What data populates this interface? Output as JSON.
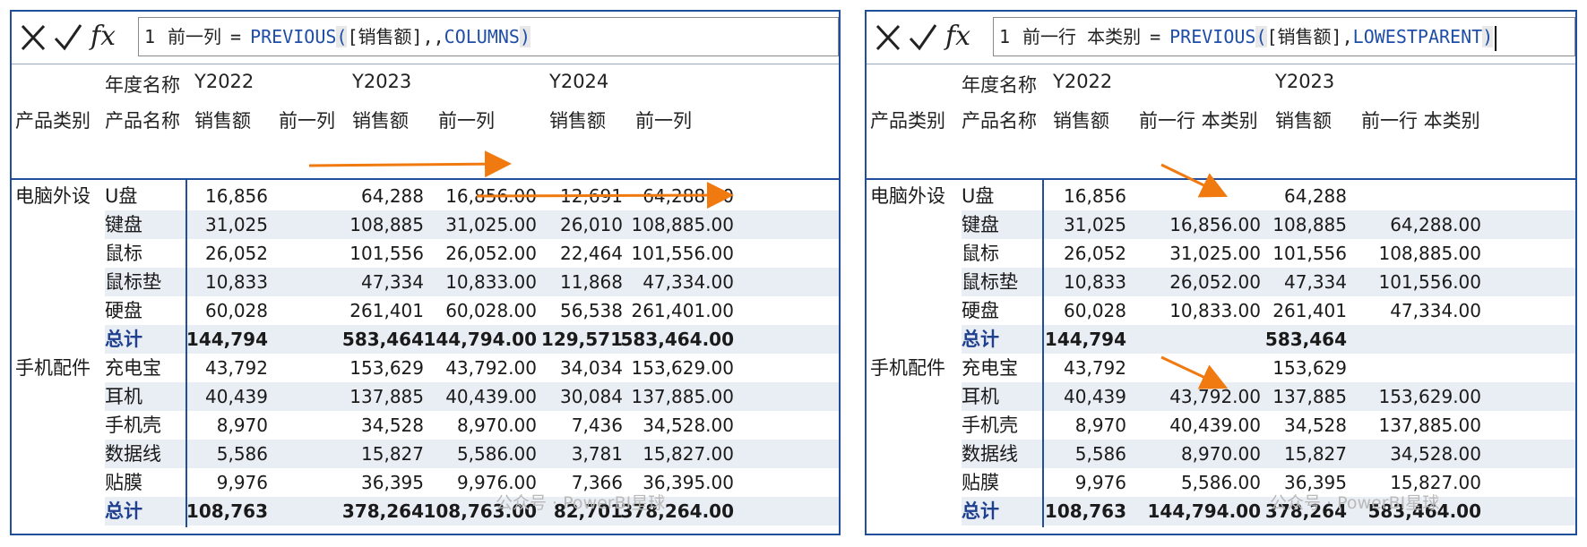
{
  "colors": {
    "border": "#1f4e9b",
    "arrow": "#f07a10",
    "band": "#e9edf4",
    "func": "#1f4ea8"
  },
  "left": {
    "toolbar": {
      "cancel_icon": "close-icon",
      "commit_icon": "check-icon",
      "fx_label": "fx"
    },
    "formula": {
      "line": "1",
      "name": "前一列",
      "eq": "=",
      "func": "PREVIOUS",
      "open": "(",
      "ref": "[销售额]",
      "sep": ",,",
      "kw": "COLUMNS",
      "close": ")"
    },
    "headers": {
      "year_name": "年度名称",
      "product_category": "产品类别",
      "product_name": "产品名称",
      "years": [
        "Y2022",
        "Y2023",
        "Y2024"
      ],
      "measures": [
        "销售额",
        "前一列",
        "销售额",
        "前一列",
        "销售额",
        "前一列"
      ]
    },
    "groups": [
      {
        "category": "电脑外设",
        "rows": [
          {
            "name": "U盘",
            "v": [
              "16,856",
              "",
              "64,288",
              "16,856.00",
              "12,691",
              "64,288.00"
            ]
          },
          {
            "name": "键盘",
            "v": [
              "31,025",
              "",
              "108,885",
              "31,025.00",
              "26,010",
              "108,885.00"
            ]
          },
          {
            "name": "鼠标",
            "v": [
              "26,052",
              "",
              "101,556",
              "26,052.00",
              "22,464",
              "101,556.00"
            ]
          },
          {
            "name": "鼠标垫",
            "v": [
              "10,833",
              "",
              "47,334",
              "10,833.00",
              "11,868",
              "47,334.00"
            ]
          },
          {
            "name": "硬盘",
            "v": [
              "60,028",
              "",
              "261,401",
              "60,028.00",
              "56,538",
              "261,401.00"
            ]
          }
        ],
        "total": {
          "name": "总计",
          "v": [
            "144,794",
            "",
            "583,464",
            "144,794.00",
            "129,571",
            "583,464.00"
          ]
        }
      },
      {
        "category": "手机配件",
        "rows": [
          {
            "name": "充电宝",
            "v": [
              "43,792",
              "",
              "153,629",
              "43,792.00",
              "34,034",
              "153,629.00"
            ]
          },
          {
            "name": "耳机",
            "v": [
              "40,439",
              "",
              "137,885",
              "40,439.00",
              "30,084",
              "137,885.00"
            ]
          },
          {
            "name": "手机壳",
            "v": [
              "8,970",
              "",
              "34,528",
              "8,970.00",
              "7,436",
              "34,528.00"
            ]
          },
          {
            "name": "数据线",
            "v": [
              "5,586",
              "",
              "15,827",
              "5,586.00",
              "3,781",
              "15,827.00"
            ]
          },
          {
            "name": "贴膜",
            "v": [
              "9,976",
              "",
              "36,395",
              "9,976.00",
              "7,366",
              "36,395.00"
            ]
          }
        ],
        "total": {
          "name": "总计",
          "v": [
            "108,763",
            "",
            "378,264",
            "108,763.00",
            "82,701",
            "378,264.00"
          ]
        }
      }
    ],
    "watermark": "公众号 · PowerBI星球"
  },
  "right": {
    "toolbar": {
      "cancel_icon": "close-icon",
      "commit_icon": "check-icon",
      "fx_label": "fx"
    },
    "formula": {
      "line": "1",
      "name": "前一行 本类别",
      "eq": "=",
      "func": "PREVIOUS",
      "open": "(",
      "ref": "[销售额]",
      "sep": ",",
      "kw": "LOWESTPARENT",
      "close": ")"
    },
    "headers": {
      "year_name": "年度名称",
      "product_category": "产品类别",
      "product_name": "产品名称",
      "years": [
        "Y2022",
        "Y2023"
      ],
      "measures": [
        "销售额",
        "前一行 本类别",
        "销售额",
        "前一行 本类别"
      ]
    },
    "groups": [
      {
        "category": "电脑外设",
        "rows": [
          {
            "name": "U盘",
            "v": [
              "16,856",
              "",
              "64,288",
              ""
            ]
          },
          {
            "name": "键盘",
            "v": [
              "31,025",
              "16,856.00",
              "108,885",
              "64,288.00"
            ]
          },
          {
            "name": "鼠标",
            "v": [
              "26,052",
              "31,025.00",
              "101,556",
              "108,885.00"
            ]
          },
          {
            "name": "鼠标垫",
            "v": [
              "10,833",
              "26,052.00",
              "47,334",
              "101,556.00"
            ]
          },
          {
            "name": "硬盘",
            "v": [
              "60,028",
              "10,833.00",
              "261,401",
              "47,334.00"
            ]
          }
        ],
        "total": {
          "name": "总计",
          "v": [
            "144,794",
            "",
            "583,464",
            ""
          ]
        }
      },
      {
        "category": "手机配件",
        "rows": [
          {
            "name": "充电宝",
            "v": [
              "43,792",
              "",
              "153,629",
              ""
            ]
          },
          {
            "name": "耳机",
            "v": [
              "40,439",
              "43,792.00",
              "137,885",
              "153,629.00"
            ]
          },
          {
            "name": "手机壳",
            "v": [
              "8,970",
              "40,439.00",
              "34,528",
              "137,885.00"
            ]
          },
          {
            "name": "数据线",
            "v": [
              "5,586",
              "8,970.00",
              "15,827",
              "34,528.00"
            ]
          },
          {
            "name": "贴膜",
            "v": [
              "9,976",
              "5,586.00",
              "36,395",
              "15,827.00"
            ]
          }
        ],
        "total": {
          "name": "总计",
          "v": [
            "108,763",
            "144,794.00",
            "378,264",
            "583,464.00"
          ]
        }
      }
    ],
    "watermark": "公众号 · PowerBI星球"
  }
}
